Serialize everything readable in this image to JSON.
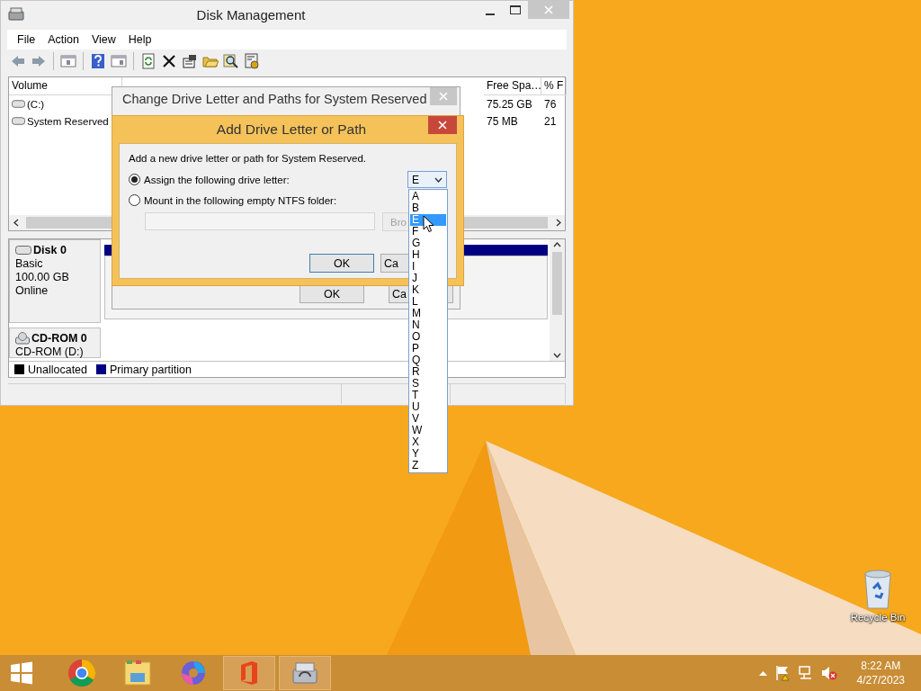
{
  "desktop": {
    "icons": [
      {
        "label": "Recycle Bin"
      }
    ]
  },
  "disk_management": {
    "title": "Disk Management",
    "menu": [
      "File",
      "Action",
      "View",
      "Help"
    ],
    "volume_table": {
      "columns": [
        "Volume",
        "Free Spa…",
        "% F"
      ],
      "rows": [
        {
          "volume": "(C:)",
          "free_space": "75.25 GB",
          "percent_free": "76"
        },
        {
          "volume": "System Reserved",
          "free_space": "75 MB",
          "percent_free": "21"
        }
      ]
    },
    "disks": [
      {
        "kind": "disk",
        "name": "Disk 0",
        "lines": [
          "Basic",
          "100.00 GB",
          "Online"
        ]
      },
      {
        "kind": "cdrom",
        "name": "CD-ROM 0",
        "lines": [
          "CD-ROM (D:)"
        ]
      }
    ],
    "legend": [
      {
        "label": "Unallocated",
        "color": "#000000"
      },
      {
        "label": "Primary partition",
        "color": "#000080"
      }
    ]
  },
  "change_dialog": {
    "title": "Change Drive Letter and Paths for System Reserved",
    "buttons": [
      "OK",
      "Ca"
    ]
  },
  "add_dialog": {
    "title": "Add Drive Letter or Path",
    "description": "Add a new drive letter or path for System Reserved.",
    "options": [
      {
        "label": "Assign the following drive letter:",
        "selected": true
      },
      {
        "label": "Mount in the following empty NTFS folder:",
        "selected": false
      }
    ],
    "drive_select": {
      "value": "E",
      "expanded": true,
      "options": [
        {
          "label": "A",
          "selected": false
        },
        {
          "label": "B",
          "selected": false
        },
        {
          "label": "E",
          "selected": true
        },
        {
          "label": "F",
          "selected": false
        },
        {
          "label": "G",
          "selected": false
        },
        {
          "label": "H",
          "selected": false
        },
        {
          "label": "I",
          "selected": false
        },
        {
          "label": "J",
          "selected": false
        },
        {
          "label": "K",
          "selected": false
        },
        {
          "label": "L",
          "selected": false
        },
        {
          "label": "M",
          "selected": false
        },
        {
          "label": "N",
          "selected": false
        },
        {
          "label": "O",
          "selected": false
        },
        {
          "label": "P",
          "selected": false
        },
        {
          "label": "Q",
          "selected": false
        },
        {
          "label": "R",
          "selected": false
        },
        {
          "label": "S",
          "selected": false
        },
        {
          "label": "T",
          "selected": false
        },
        {
          "label": "U",
          "selected": false
        },
        {
          "label": "V",
          "selected": false
        },
        {
          "label": "W",
          "selected": false
        },
        {
          "label": "X",
          "selected": false
        },
        {
          "label": "Y",
          "selected": false
        },
        {
          "label": "Z",
          "selected": false
        }
      ]
    },
    "browse_button": "Bro",
    "buttons": [
      "OK",
      "Ca"
    ]
  },
  "taskbar": {
    "apps": [
      {
        "kind": "chrome",
        "running": false
      },
      {
        "kind": "explorer",
        "running": false
      },
      {
        "kind": "copilot",
        "running": false
      },
      {
        "kind": "office",
        "running": true
      },
      {
        "kind": "disk",
        "running": true
      }
    ],
    "clock": {
      "time": "8:22 AM",
      "date": "4/27/2023"
    }
  }
}
